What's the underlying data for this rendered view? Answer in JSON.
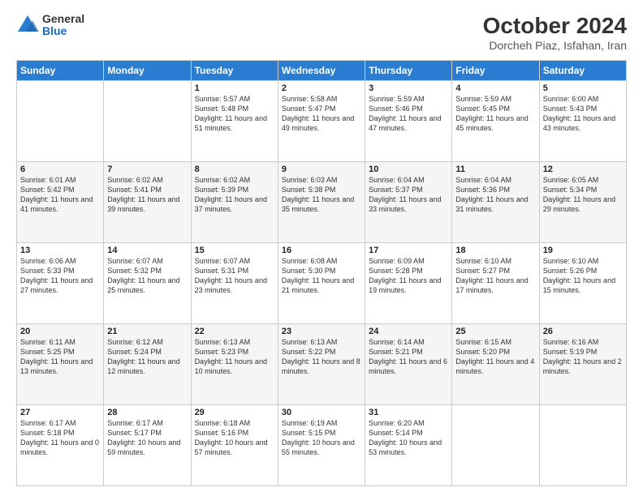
{
  "logo": {
    "general": "General",
    "blue": "Blue"
  },
  "header": {
    "month_title": "October 2024",
    "location": "Dorcheh Piaz, Isfahan, Iran"
  },
  "weekdays": [
    "Sunday",
    "Monday",
    "Tuesday",
    "Wednesday",
    "Thursday",
    "Friday",
    "Saturday"
  ],
  "weeks": [
    [
      {
        "day": "",
        "info": ""
      },
      {
        "day": "",
        "info": ""
      },
      {
        "day": "1",
        "info": "Sunrise: 5:57 AM\nSunset: 5:48 PM\nDaylight: 11 hours and 51 minutes."
      },
      {
        "day": "2",
        "info": "Sunrise: 5:58 AM\nSunset: 5:47 PM\nDaylight: 11 hours and 49 minutes."
      },
      {
        "day": "3",
        "info": "Sunrise: 5:59 AM\nSunset: 5:46 PM\nDaylight: 11 hours and 47 minutes."
      },
      {
        "day": "4",
        "info": "Sunrise: 5:59 AM\nSunset: 5:45 PM\nDaylight: 11 hours and 45 minutes."
      },
      {
        "day": "5",
        "info": "Sunrise: 6:00 AM\nSunset: 5:43 PM\nDaylight: 11 hours and 43 minutes."
      }
    ],
    [
      {
        "day": "6",
        "info": "Sunrise: 6:01 AM\nSunset: 5:42 PM\nDaylight: 11 hours and 41 minutes."
      },
      {
        "day": "7",
        "info": "Sunrise: 6:02 AM\nSunset: 5:41 PM\nDaylight: 11 hours and 39 minutes."
      },
      {
        "day": "8",
        "info": "Sunrise: 6:02 AM\nSunset: 5:39 PM\nDaylight: 11 hours and 37 minutes."
      },
      {
        "day": "9",
        "info": "Sunrise: 6:03 AM\nSunset: 5:38 PM\nDaylight: 11 hours and 35 minutes."
      },
      {
        "day": "10",
        "info": "Sunrise: 6:04 AM\nSunset: 5:37 PM\nDaylight: 11 hours and 33 minutes."
      },
      {
        "day": "11",
        "info": "Sunrise: 6:04 AM\nSunset: 5:36 PM\nDaylight: 11 hours and 31 minutes."
      },
      {
        "day": "12",
        "info": "Sunrise: 6:05 AM\nSunset: 5:34 PM\nDaylight: 11 hours and 29 minutes."
      }
    ],
    [
      {
        "day": "13",
        "info": "Sunrise: 6:06 AM\nSunset: 5:33 PM\nDaylight: 11 hours and 27 minutes."
      },
      {
        "day": "14",
        "info": "Sunrise: 6:07 AM\nSunset: 5:32 PM\nDaylight: 11 hours and 25 minutes."
      },
      {
        "day": "15",
        "info": "Sunrise: 6:07 AM\nSunset: 5:31 PM\nDaylight: 11 hours and 23 minutes."
      },
      {
        "day": "16",
        "info": "Sunrise: 6:08 AM\nSunset: 5:30 PM\nDaylight: 11 hours and 21 minutes."
      },
      {
        "day": "17",
        "info": "Sunrise: 6:09 AM\nSunset: 5:28 PM\nDaylight: 11 hours and 19 minutes."
      },
      {
        "day": "18",
        "info": "Sunrise: 6:10 AM\nSunset: 5:27 PM\nDaylight: 11 hours and 17 minutes."
      },
      {
        "day": "19",
        "info": "Sunrise: 6:10 AM\nSunset: 5:26 PM\nDaylight: 11 hours and 15 minutes."
      }
    ],
    [
      {
        "day": "20",
        "info": "Sunrise: 6:11 AM\nSunset: 5:25 PM\nDaylight: 11 hours and 13 minutes."
      },
      {
        "day": "21",
        "info": "Sunrise: 6:12 AM\nSunset: 5:24 PM\nDaylight: 11 hours and 12 minutes."
      },
      {
        "day": "22",
        "info": "Sunrise: 6:13 AM\nSunset: 5:23 PM\nDaylight: 11 hours and 10 minutes."
      },
      {
        "day": "23",
        "info": "Sunrise: 6:13 AM\nSunset: 5:22 PM\nDaylight: 11 hours and 8 minutes."
      },
      {
        "day": "24",
        "info": "Sunrise: 6:14 AM\nSunset: 5:21 PM\nDaylight: 11 hours and 6 minutes."
      },
      {
        "day": "25",
        "info": "Sunrise: 6:15 AM\nSunset: 5:20 PM\nDaylight: 11 hours and 4 minutes."
      },
      {
        "day": "26",
        "info": "Sunrise: 6:16 AM\nSunset: 5:19 PM\nDaylight: 11 hours and 2 minutes."
      }
    ],
    [
      {
        "day": "27",
        "info": "Sunrise: 6:17 AM\nSunset: 5:18 PM\nDaylight: 11 hours and 0 minutes."
      },
      {
        "day": "28",
        "info": "Sunrise: 6:17 AM\nSunset: 5:17 PM\nDaylight: 10 hours and 59 minutes."
      },
      {
        "day": "29",
        "info": "Sunrise: 6:18 AM\nSunset: 5:16 PM\nDaylight: 10 hours and 57 minutes."
      },
      {
        "day": "30",
        "info": "Sunrise: 6:19 AM\nSunset: 5:15 PM\nDaylight: 10 hours and 55 minutes."
      },
      {
        "day": "31",
        "info": "Sunrise: 6:20 AM\nSunset: 5:14 PM\nDaylight: 10 hours and 53 minutes."
      },
      {
        "day": "",
        "info": ""
      },
      {
        "day": "",
        "info": ""
      }
    ]
  ]
}
